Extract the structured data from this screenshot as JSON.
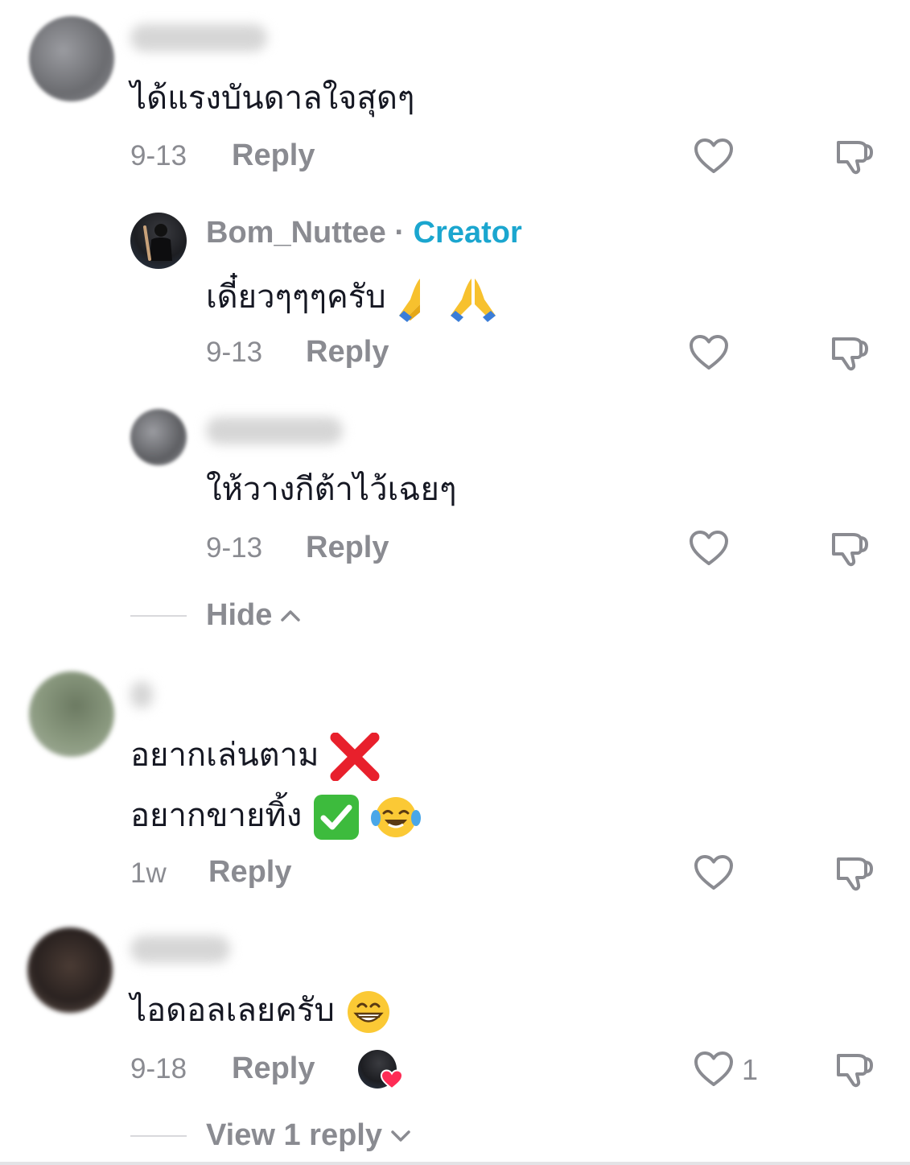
{
  "colors": {
    "text": "#161823",
    "meta": "#8a8b91",
    "creator_badge": "#1ba6cf",
    "like_heart_badge": "#fe2c55"
  },
  "comments": [
    {
      "text": "ได้แรงบันดาลใจสุดๆ",
      "date": "9-13",
      "reply_label": "Reply",
      "replies": [
        {
          "username": "Bom_Nuttee",
          "separator": " · ",
          "badge": "Creator",
          "text": "เดี๋ยวๆๆๆครับ",
          "date": "9-13",
          "reply_label": "Reply"
        },
        {
          "text": "ให้วางกีต้าไว้เฉยๆ",
          "date": "9-13",
          "reply_label": "Reply"
        }
      ],
      "toggle_label": "Hide"
    },
    {
      "text_line1": "อยากเล่นตาม",
      "text_line2": "อยากขายทิ้ง",
      "date": "1w",
      "reply_label": "Reply"
    },
    {
      "text": "ไอดอลเลยครับ",
      "date": "9-18",
      "reply_label": "Reply",
      "like_count": "1",
      "toggle_label": "View 1 reply"
    }
  ]
}
